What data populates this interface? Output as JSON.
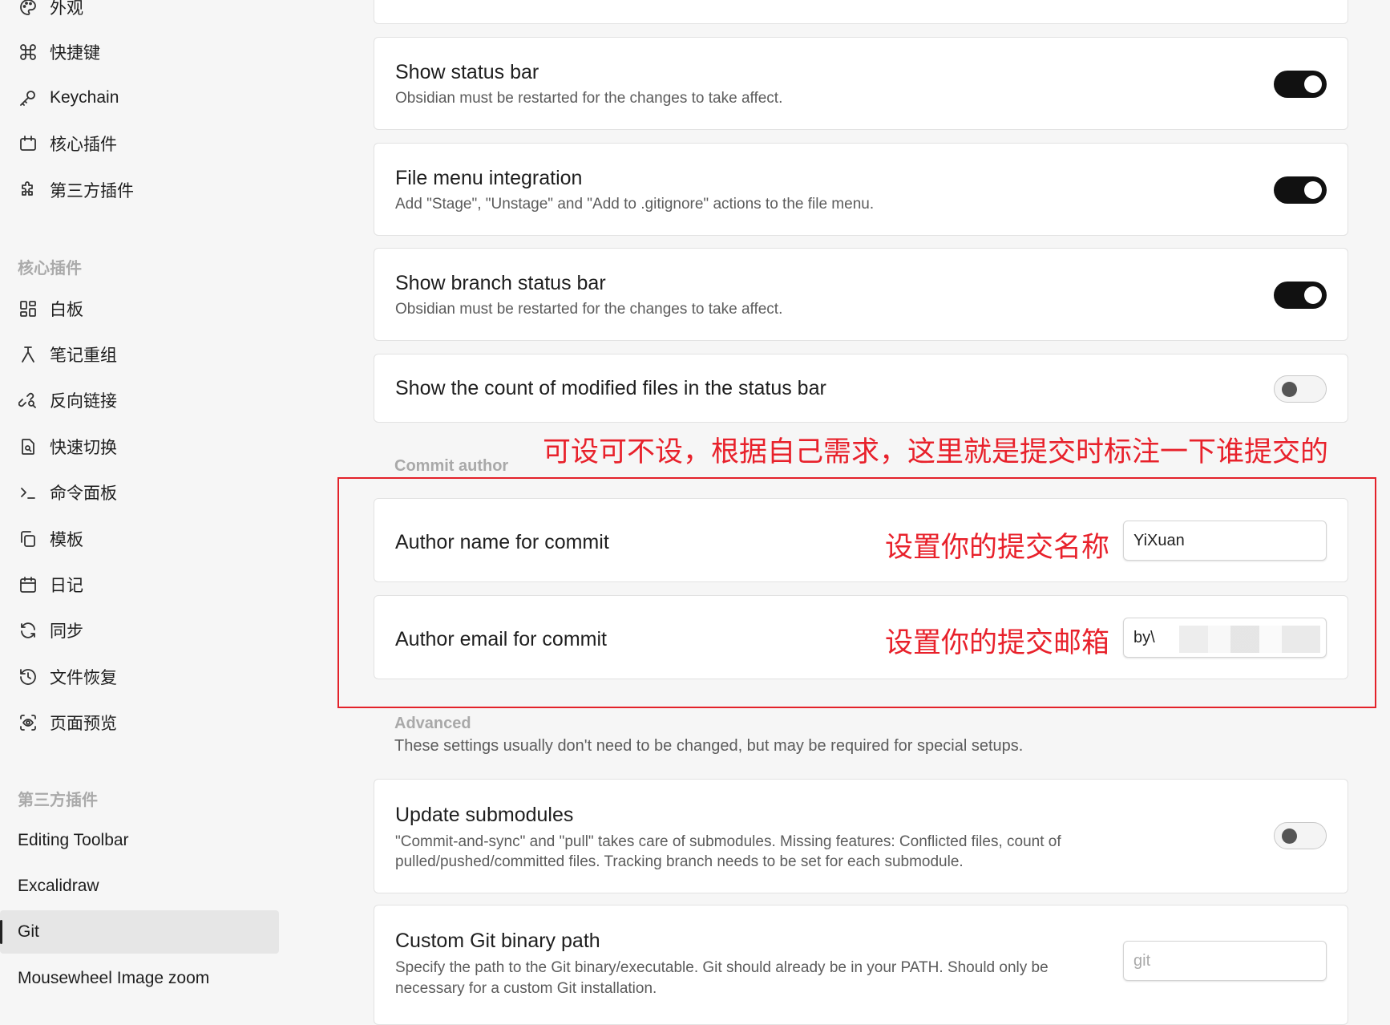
{
  "sidebar": {
    "top_items": [
      {
        "label": "外观",
        "icon": "palette-icon"
      },
      {
        "label": "快捷键",
        "icon": "command-icon"
      },
      {
        "label": "Keychain",
        "icon": "key-icon"
      },
      {
        "label": "核心插件",
        "icon": "plug-icon"
      },
      {
        "label": "第三方插件",
        "icon": "puzzle-icon"
      }
    ],
    "core_header": "核心插件",
    "core_items": [
      {
        "label": "白板",
        "icon": "layout-dashboard-icon"
      },
      {
        "label": "笔记重组",
        "icon": "merge-icon"
      },
      {
        "label": "反向链接",
        "icon": "link-search-icon"
      },
      {
        "label": "快速切换",
        "icon": "file-search-icon"
      },
      {
        "label": "命令面板",
        "icon": "terminal-icon"
      },
      {
        "label": "模板",
        "icon": "copy-icon"
      },
      {
        "label": "日记",
        "icon": "calendar-icon"
      },
      {
        "label": "同步",
        "icon": "refresh-icon"
      },
      {
        "label": "文件恢复",
        "icon": "history-icon"
      },
      {
        "label": "页面预览",
        "icon": "scan-eye-icon"
      }
    ],
    "community_header": "第三方插件",
    "community_items": [
      {
        "label": "Editing Toolbar"
      },
      {
        "label": "Excalidraw"
      },
      {
        "label": "Git"
      },
      {
        "label": "Mousewheel Image zoom"
      }
    ],
    "active_item": "Git"
  },
  "settings": {
    "show_status_bar": {
      "title": "Show status bar",
      "desc": "Obsidian must be restarted for the changes to take affect.",
      "enabled": true
    },
    "file_menu": {
      "title": "File menu integration",
      "desc": "Add \"Stage\", \"Unstage\" and \"Add to .gitignore\" actions to the file menu.",
      "enabled": true
    },
    "branch_status_bar": {
      "title": "Show branch status bar",
      "desc": "Obsidian must be restarted for the changes to take affect.",
      "enabled": true
    },
    "modified_count": {
      "title": "Show the count of modified files in the status bar",
      "enabled": false
    },
    "commit_author_label": "Commit author",
    "author_name": {
      "title": "Author name for commit",
      "value": "YiXuan"
    },
    "author_email": {
      "title": "Author email for commit",
      "value": "by\\"
    },
    "advanced_label": "Advanced",
    "advanced_desc": "These settings usually don't need to be changed, but may be required for special setups.",
    "update_submodules": {
      "title": "Update submodules",
      "desc_line1": "\"Commit-and-sync\" and \"pull\" takes care of submodules. Missing features: Conflicted files, count of",
      "desc_line2": "pulled/pushed/committed files. Tracking branch needs to be set for each submodule.",
      "enabled": false
    },
    "custom_git_path": {
      "title": "Custom Git binary path",
      "desc_line1": "Specify the path to the Git binary/executable. Git should already be in your PATH. Should only be",
      "desc_line2": "necessary for a custom Git installation.",
      "placeholder": "git",
      "value": ""
    }
  },
  "annotations": {
    "top": "可设可不设，根据自己需求，这里就是提交时标注一下谁提交的",
    "name": "设置你的提交名称",
    "email": "设置你的提交邮箱"
  },
  "colors": {
    "annotation": "#e8212b",
    "toggle_on": "#111111",
    "active_bg": "#e6e6e6"
  }
}
